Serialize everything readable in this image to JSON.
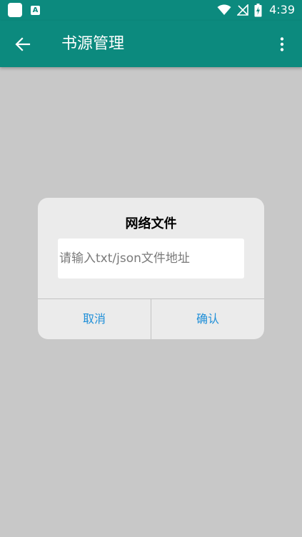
{
  "status_bar": {
    "time": "4:39",
    "icons": [
      "notification-square-icon",
      "a-notification-icon",
      "wifi-icon",
      "no-signal-icon",
      "battery-charging-icon"
    ]
  },
  "app_bar": {
    "title": "书源管理",
    "back_icon": "arrow-back-icon",
    "menu_icon": "more-vert-icon"
  },
  "dialog": {
    "title": "网络文件",
    "input": {
      "value": "",
      "placeholder": "请输入txt/json文件地址"
    },
    "cancel_label": "取消",
    "confirm_label": "确认"
  },
  "colors": {
    "primary": "#0c8a7e",
    "scrim_background": "#c8c8c8",
    "dialog_background": "#ebebeb",
    "button_text": "#1f8fd8"
  }
}
